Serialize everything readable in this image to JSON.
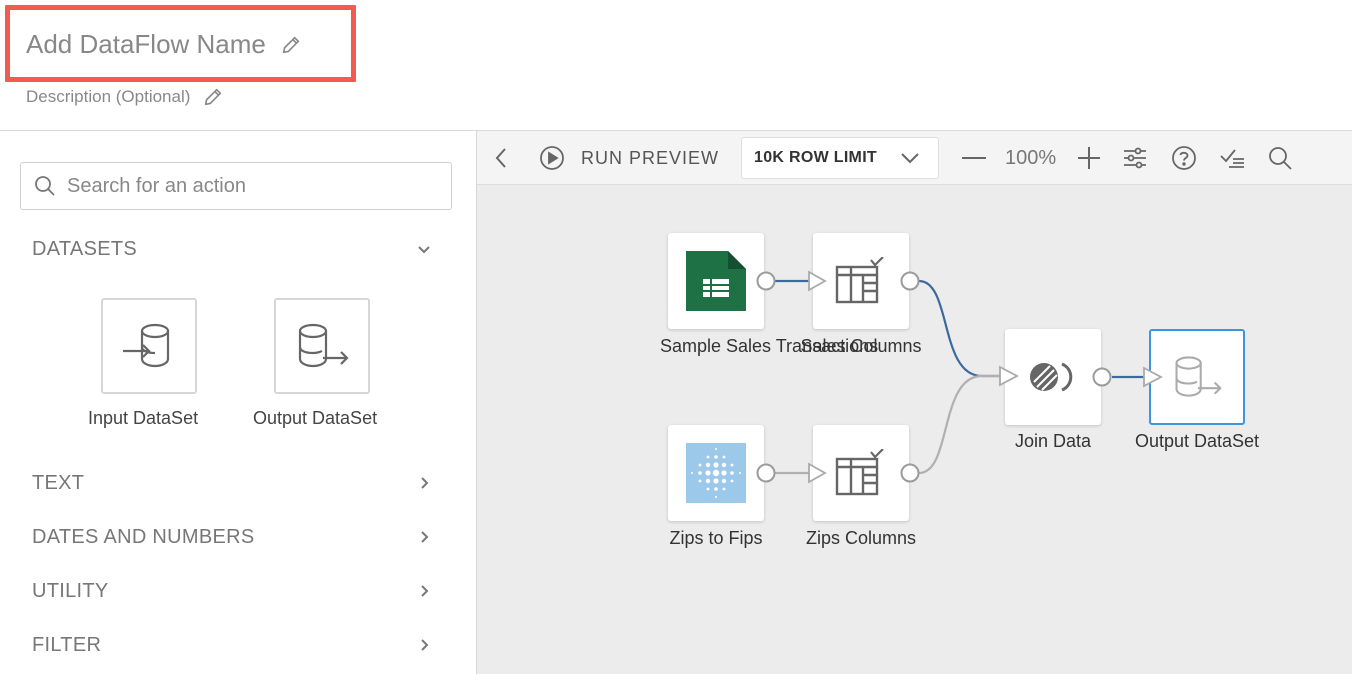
{
  "header": {
    "title": "Add DataFlow Name",
    "description": "Description (Optional)"
  },
  "sidebar": {
    "search_placeholder": "Search for an action",
    "sections": [
      {
        "label": "DATASETS",
        "expanded": true
      },
      {
        "label": "TEXT",
        "expanded": false
      },
      {
        "label": "DATES AND NUMBERS",
        "expanded": false
      },
      {
        "label": "UTILITY",
        "expanded": false
      },
      {
        "label": "FILTER",
        "expanded": false
      }
    ],
    "dataset_actions": [
      {
        "label": "Input DataSet",
        "icon": "input-dataset-icon"
      },
      {
        "label": "Output DataSet",
        "icon": "output-dataset-icon"
      }
    ]
  },
  "toolbar": {
    "run_preview": "RUN PREVIEW",
    "row_limit": "10K ROW LIMIT",
    "zoom": "100%"
  },
  "flow": {
    "nodes": [
      {
        "label": "Sample Sales Transactions",
        "icon": "spreadsheet-icon"
      },
      {
        "label": "Sales Columns",
        "icon": "columns-icon"
      },
      {
        "label": "Zips to Fips",
        "icon": "dots-grid-icon"
      },
      {
        "label": "Zips Columns",
        "icon": "columns-icon"
      },
      {
        "label": "Join Data",
        "icon": "join-icon"
      },
      {
        "label": "Output DataSet",
        "icon": "output-dataset-icon",
        "selected": true
      }
    ]
  },
  "colors": {
    "highlight_border": "#f45b50",
    "selected_border": "#3e95dd",
    "link_active": "#3d6a9e",
    "link_inactive": "#b0b0b0",
    "spreadsheet_green": "#1e7145"
  }
}
